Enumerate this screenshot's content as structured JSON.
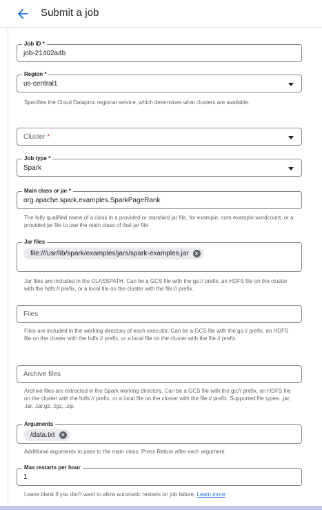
{
  "header": {
    "title": "Submit a job"
  },
  "fields": {
    "job_id": {
      "label": "Job ID *",
      "value": "job-21402a4b"
    },
    "region": {
      "label": "Region *",
      "value": "us-central1",
      "help": "Specifies the Cloud Dataproc regional service, which determines what clusters are available."
    },
    "cluster": {
      "placeholder": "Cluster",
      "required_mark": "*"
    },
    "job_type": {
      "label": "Job type *",
      "value": "Spark"
    },
    "main_class": {
      "label": "Main class or jar *",
      "value": "org.apache.spark.examples.SparkPageRank",
      "help": "The fully qualified name of a class in a provided or standard jar file, for example, com.example.wordcount, or a provided jar file to use the main class of that jar file"
    },
    "jar_files": {
      "label": "Jar files",
      "chip": "file:///usr/lib/spark/examples/jars/spark-examples.jar",
      "help": "Jar files are included in the CLASSPATH. Can be a GCS file with the gs:// prefix, an HDFS file on the cluster with the hdfs:// prefix, or a local file on the cluster with the file:// prefix."
    },
    "files": {
      "placeholder": "Files",
      "help": "Files are included in the working directory of each executor. Can be a GCS file with the gs:// prefix, an HDFS file on the cluster with the hdfs:// prefix, or a local file on the cluster with the file:// prefix."
    },
    "archive_files": {
      "placeholder": "Archive files",
      "help": "Archive files are extracted in the Spark working directory. Can be a GCS file with the gs:// prefix, an HDFS file on the cluster with the hdfs:// prefix, or a local file on the cluster with the file:// prefix. Supported file types: .jar, .tar, .tar.gz, .tgz, .zip."
    },
    "arguments": {
      "label": "Arguments",
      "chip": "/data.txt",
      "help": "Additional arguments to pass to the main class. Press Return after each argument."
    },
    "max_restarts": {
      "label": "Max restarts per hour",
      "value": "1",
      "help": "Leave blank if you don't want to allow automatic restarts on job failure.",
      "link": "Learn more"
    }
  },
  "icons": {
    "back": "arrow-back-icon",
    "dropdown": "caret-down-icon",
    "chip_remove": "cancel-circle-icon"
  },
  "colors": {
    "accent": "#1a73e8",
    "required": "#d93025",
    "border": "#80868b",
    "help_text": "#5f6368"
  }
}
